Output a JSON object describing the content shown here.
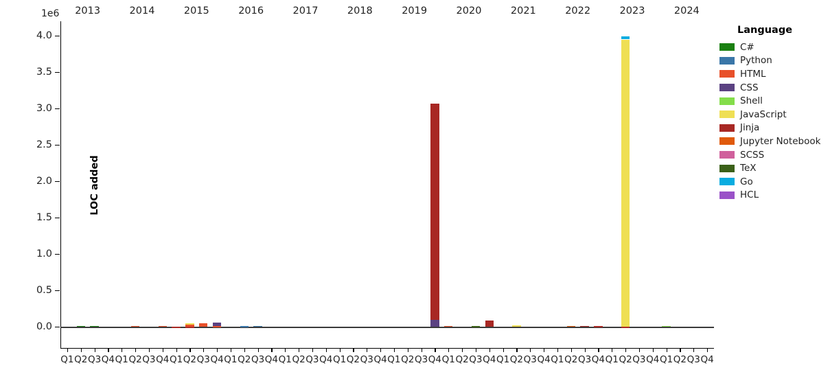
{
  "chart_data": {
    "type": "bar",
    "title": "",
    "subtitle": "",
    "xlabel": "",
    "ylabel": "LOC added",
    "y_exponent_label": "1e6",
    "ylim": [
      -300000,
      4200000
    ],
    "yticks": [
      0,
      500000,
      1000000,
      1500000,
      2000000,
      2500000,
      3000000,
      3500000,
      4000000
    ],
    "ytick_labels": [
      "0.0",
      "0.5",
      "1.0",
      "1.5",
      "2.0",
      "2.5",
      "3.0",
      "3.5",
      "4.0"
    ],
    "grid": false,
    "stacked": true,
    "legend_position": "right",
    "legend_title": "Language",
    "years": [
      "2013",
      "2014",
      "2015",
      "2016",
      "2017",
      "2018",
      "2019",
      "2020",
      "2021",
      "2022",
      "2023",
      "2024"
    ],
    "quarters": [
      "Q1",
      "Q2",
      "Q3",
      "Q4"
    ],
    "categories": [
      "2013-Q1",
      "2013-Q2",
      "2013-Q3",
      "2013-Q4",
      "2014-Q1",
      "2014-Q2",
      "2014-Q3",
      "2014-Q4",
      "2015-Q1",
      "2015-Q2",
      "2015-Q3",
      "2015-Q4",
      "2016-Q1",
      "2016-Q2",
      "2016-Q3",
      "2016-Q4",
      "2017-Q1",
      "2017-Q2",
      "2017-Q3",
      "2017-Q4",
      "2018-Q1",
      "2018-Q2",
      "2018-Q3",
      "2018-Q4",
      "2019-Q1",
      "2019-Q2",
      "2019-Q3",
      "2019-Q4",
      "2020-Q1",
      "2020-Q2",
      "2020-Q3",
      "2020-Q4",
      "2021-Q1",
      "2021-Q2",
      "2021-Q3",
      "2021-Q4",
      "2022-Q1",
      "2022-Q2",
      "2022-Q3",
      "2022-Q4",
      "2023-Q1",
      "2023-Q2",
      "2023-Q3",
      "2023-Q4",
      "2024-Q1",
      "2024-Q2",
      "2024-Q3",
      "2024-Q4"
    ],
    "legend_entries": [
      {
        "label": "C#",
        "color": "#1a8011"
      },
      {
        "label": "Python",
        "color": "#3a76a8"
      },
      {
        "label": "HTML",
        "color": "#e8502a"
      },
      {
        "label": "CSS",
        "color": "#5b4282"
      },
      {
        "label": "Shell",
        "color": "#84dd4a"
      },
      {
        "label": "JavaScript",
        "color": "#efdf54"
      },
      {
        "label": "Jinja",
        "color": "#a82824"
      },
      {
        "label": "Jupyter Notebook",
        "color": "#e05a0c"
      },
      {
        "label": "SCSS",
        "color": "#d0609c"
      },
      {
        "label": "TeX",
        "color": "#3b6018"
      },
      {
        "label": "Go",
        "color": "#09ace0"
      },
      {
        "label": "HCL",
        "color": "#9a52c8"
      }
    ],
    "series": [
      {
        "name": "C#",
        "color": "#1a8011",
        "values": [
          0,
          14000,
          13000,
          0,
          0,
          0,
          0,
          0,
          0,
          0,
          0,
          0,
          0,
          0,
          0,
          0,
          0,
          0,
          0,
          0,
          0,
          0,
          0,
          0,
          0,
          0,
          0,
          0,
          0,
          0,
          0,
          0,
          0,
          0,
          0,
          0,
          0,
          0,
          0,
          0,
          0,
          0,
          0,
          0,
          0,
          0,
          0,
          0
        ]
      },
      {
        "name": "Python",
        "color": "#3a76a8",
        "values": [
          0,
          0,
          0,
          0,
          0,
          0,
          0,
          0,
          0,
          0,
          0,
          0,
          0,
          9000,
          11000,
          0,
          0,
          0,
          0,
          0,
          0,
          0,
          0,
          0,
          0,
          0,
          0,
          0,
          0,
          0,
          0,
          0,
          0,
          0,
          0,
          0,
          0,
          0,
          0,
          0,
          0,
          0,
          0,
          0,
          0,
          0,
          0,
          0
        ]
      },
      {
        "name": "HTML",
        "color": "#e8502a",
        "values": [
          0,
          0,
          0,
          0,
          0,
          12000,
          0,
          14000,
          0,
          34000,
          52000,
          8000,
          0,
          0,
          0,
          0,
          0,
          0,
          0,
          0,
          0,
          0,
          0,
          0,
          0,
          0,
          0,
          0,
          11000,
          0,
          0,
          0,
          0,
          0,
          0,
          0,
          0,
          0,
          0,
          0,
          0,
          0,
          0,
          0,
          0,
          0,
          0,
          0
        ]
      },
      {
        "name": "CSS",
        "color": "#5b4282",
        "values": [
          0,
          0,
          0,
          0,
          0,
          0,
          0,
          0,
          0,
          0,
          0,
          52000,
          0,
          0,
          0,
          0,
          0,
          0,
          0,
          0,
          0,
          0,
          0,
          0,
          0,
          0,
          0,
          98000,
          0,
          0,
          0,
          0,
          0,
          0,
          0,
          0,
          0,
          0,
          0,
          0,
          0,
          0,
          0,
          0,
          0,
          0,
          0,
          0
        ]
      },
      {
        "name": "Shell",
        "color": "#84dd4a",
        "values": [
          0,
          0,
          0,
          0,
          0,
          0,
          0,
          0,
          0,
          0,
          0,
          0,
          0,
          0,
          0,
          0,
          0,
          0,
          0,
          0,
          0,
          0,
          0,
          0,
          0,
          0,
          0,
          0,
          0,
          0,
          0,
          0,
          0,
          0,
          0,
          0,
          0,
          0,
          0,
          0,
          0,
          0,
          0,
          0,
          13000,
          0,
          0,
          0
        ]
      },
      {
        "name": "JavaScript",
        "color": "#efdf54",
        "values": [
          0,
          0,
          0,
          0,
          0,
          0,
          0,
          0,
          0,
          18000,
          0,
          0,
          0,
          0,
          0,
          0,
          0,
          0,
          0,
          0,
          0,
          0,
          0,
          0,
          0,
          0,
          0,
          0,
          0,
          0,
          0,
          0,
          0,
          22000,
          0,
          0,
          0,
          0,
          0,
          0,
          0,
          3950000,
          0,
          0,
          0,
          0,
          0,
          0
        ]
      },
      {
        "name": "Jinja",
        "color": "#a82824",
        "values": [
          0,
          0,
          0,
          0,
          0,
          0,
          0,
          0,
          -9000,
          -14000,
          0,
          0,
          0,
          0,
          0,
          0,
          0,
          0,
          0,
          0,
          0,
          0,
          0,
          0,
          0,
          0,
          0,
          2970000,
          0,
          0,
          0,
          90000,
          0,
          0,
          0,
          0,
          0,
          0,
          11000,
          9000,
          0,
          -14000,
          0,
          0,
          0,
          0,
          0,
          0
        ]
      },
      {
        "name": "Jupyter Notebook",
        "color": "#e05a0c",
        "values": [
          0,
          0,
          0,
          0,
          0,
          0,
          0,
          0,
          0,
          0,
          0,
          0,
          0,
          0,
          0,
          0,
          0,
          0,
          0,
          0,
          0,
          0,
          0,
          0,
          0,
          0,
          0,
          0,
          0,
          0,
          0,
          0,
          0,
          0,
          0,
          0,
          0,
          13000,
          0,
          0,
          0,
          0,
          0,
          0,
          0,
          0,
          0,
          0
        ]
      },
      {
        "name": "SCSS",
        "color": "#d0609c",
        "values": [
          0,
          0,
          0,
          0,
          0,
          0,
          0,
          0,
          0,
          0,
          0,
          0,
          0,
          0,
          0,
          0,
          0,
          0,
          0,
          0,
          0,
          0,
          0,
          0,
          0,
          0,
          0,
          0,
          0,
          0,
          0,
          0,
          0,
          0,
          0,
          0,
          0,
          0,
          0,
          0,
          0,
          0,
          0,
          0,
          0,
          0,
          0,
          0
        ]
      },
      {
        "name": "TeX",
        "color": "#3b6018",
        "values": [
          0,
          0,
          0,
          0,
          0,
          0,
          0,
          0,
          0,
          0,
          0,
          0,
          0,
          0,
          0,
          0,
          0,
          0,
          0,
          0,
          0,
          0,
          0,
          0,
          0,
          0,
          0,
          0,
          0,
          0,
          9000,
          0,
          0,
          0,
          0,
          0,
          0,
          0,
          0,
          0,
          0,
          0,
          0,
          0,
          0,
          0,
          0,
          0
        ]
      },
      {
        "name": "Go",
        "color": "#09ace0",
        "values": [
          0,
          0,
          0,
          0,
          0,
          0,
          0,
          0,
          0,
          0,
          0,
          0,
          0,
          0,
          0,
          0,
          0,
          0,
          0,
          0,
          0,
          0,
          0,
          0,
          0,
          0,
          0,
          0,
          0,
          0,
          0,
          0,
          0,
          0,
          0,
          0,
          0,
          0,
          0,
          0,
          0,
          40000,
          0,
          0,
          0,
          0,
          0,
          0
        ]
      },
      {
        "name": "HCL",
        "color": "#9a52c8",
        "values": [
          0,
          0,
          0,
          0,
          0,
          0,
          0,
          0,
          0,
          0,
          0,
          0,
          0,
          0,
          0,
          0,
          0,
          0,
          0,
          0,
          0,
          0,
          0,
          0,
          0,
          0,
          0,
          0,
          0,
          0,
          0,
          0,
          0,
          0,
          0,
          0,
          0,
          0,
          0,
          0,
          0,
          0,
          0,
          0,
          0,
          0,
          0,
          0
        ]
      }
    ]
  }
}
